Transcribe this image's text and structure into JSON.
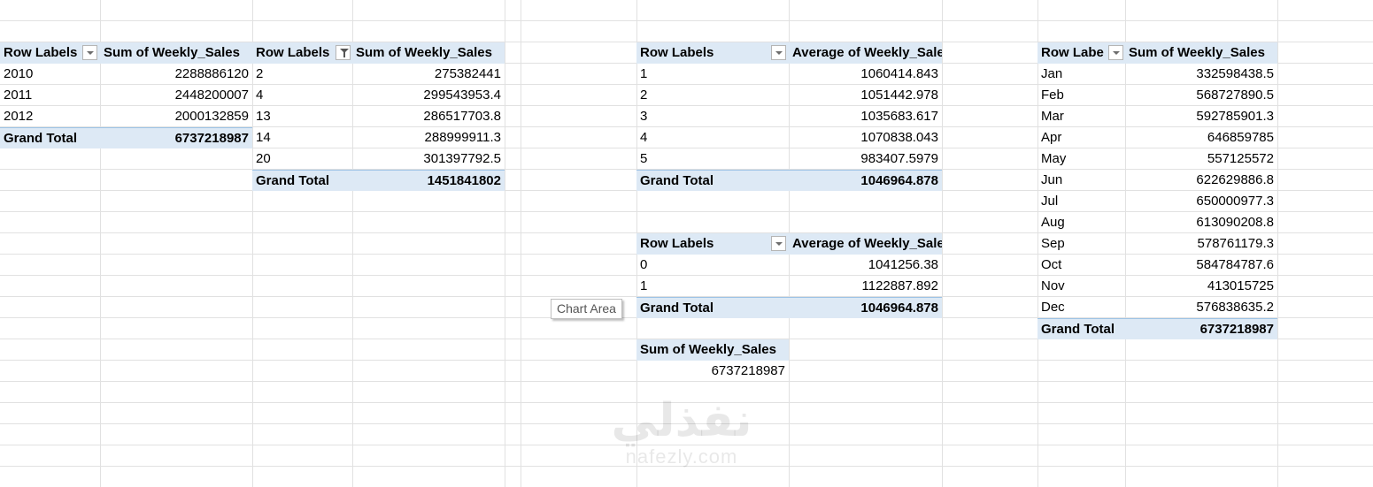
{
  "pivot_year": {
    "row_labels": "Row Labels",
    "value_header": "Sum of Weekly_Sales",
    "rows": [
      {
        "label": "2010",
        "value": "2288886120"
      },
      {
        "label": "2011",
        "value": "2448200007"
      },
      {
        "label": "2012",
        "value": "2000132859"
      }
    ],
    "total_label": "Grand Total",
    "total_value": "6737218987"
  },
  "pivot_store": {
    "row_labels": "Row Labels",
    "value_header": "Sum of Weekly_Sales",
    "rows": [
      {
        "label": "2",
        "value": "275382441"
      },
      {
        "label": "4",
        "value": "299543953.4"
      },
      {
        "label": "13",
        "value": "286517703.8"
      },
      {
        "label": "14",
        "value": "288999911.3"
      },
      {
        "label": "20",
        "value": "301397792.5"
      }
    ],
    "total_label": "Grand Total",
    "total_value": "1451841802"
  },
  "pivot_day": {
    "row_labels": "Row Labels",
    "value_header": "Average of Weekly_Sales",
    "rows": [
      {
        "label": "1",
        "value": "1060414.843"
      },
      {
        "label": "2",
        "value": "1051442.978"
      },
      {
        "label": "3",
        "value": "1035683.617"
      },
      {
        "label": "4",
        "value": "1070838.043"
      },
      {
        "label": "5",
        "value": "983407.5979"
      }
    ],
    "total_label": "Grand Total",
    "total_value": "1046964.878"
  },
  "pivot_holiday": {
    "row_labels": "Row Labels",
    "value_header": "Average of Weekly_Sales",
    "rows": [
      {
        "label": "0",
        "value": "1041256.38"
      },
      {
        "label": "1",
        "value": "1122887.892"
      }
    ],
    "total_label": "Grand Total",
    "total_value": "1046964.878"
  },
  "pivot_sum": {
    "value_header": "Sum of Weekly_Sales",
    "value": "6737218987"
  },
  "pivot_month": {
    "row_labels": "Row Labe",
    "value_header": "Sum of Weekly_Sales",
    "rows": [
      {
        "label": "Jan",
        "value": "332598438.5"
      },
      {
        "label": "Feb",
        "value": "568727890.5"
      },
      {
        "label": "Mar",
        "value": "592785901.3"
      },
      {
        "label": "Apr",
        "value": "646859785"
      },
      {
        "label": "May",
        "value": "557125572"
      },
      {
        "label": "Jun",
        "value": "622629886.8"
      },
      {
        "label": "Jul",
        "value": "650000977.3"
      },
      {
        "label": "Aug",
        "value": "613090208.8"
      },
      {
        "label": "Sep",
        "value": "578761179.3"
      },
      {
        "label": "Oct",
        "value": "584784787.6"
      },
      {
        "label": "Nov",
        "value": "413015725"
      },
      {
        "label": "Dec",
        "value": "576838635.2"
      }
    ],
    "total_label": "Grand Total",
    "total_value": "6737218987"
  },
  "tooltip": {
    "text": "Chart Area"
  },
  "watermark": {
    "logo": "نفذلي",
    "url": "nafezly.com"
  },
  "icons": {
    "dropdown": "chevron-down-icon",
    "filter": "filter-icon"
  },
  "colors": {
    "pivot_header_fill": "#dde9f5",
    "gridline": "#e1e1e1",
    "total_border": "#9dc3e6"
  }
}
